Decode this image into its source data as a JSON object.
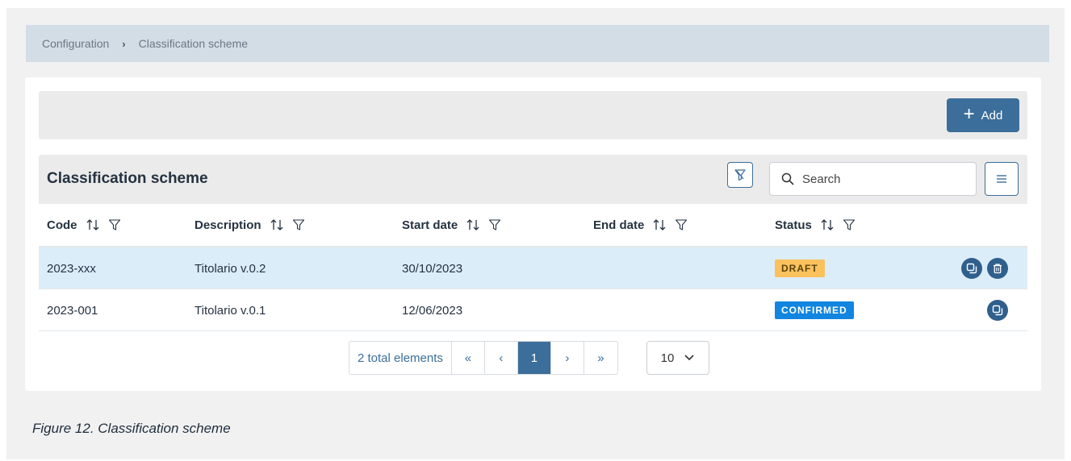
{
  "breadcrumb": {
    "items": [
      "Configuration",
      "Classification scheme"
    ],
    "separator": "›"
  },
  "toolbar": {
    "add_label": "Add"
  },
  "table": {
    "title": "Classification scheme",
    "search_placeholder": "Search",
    "columns": [
      "Code",
      "Description",
      "Start date",
      "End date",
      "Status"
    ],
    "rows": [
      {
        "code": "2023-xxx",
        "description": "Titolario v.0.2",
        "start_date": "30/10/2023",
        "end_date": "",
        "status": "DRAFT",
        "status_color": "#fbc15c",
        "actions": [
          "copy-icon",
          "delete-icon"
        ],
        "selected": true
      },
      {
        "code": "2023-001",
        "description": "Titolario v.0.1",
        "start_date": "12/06/2023",
        "end_date": "",
        "status": "CONFIRMED",
        "status_color": "#1185e0",
        "actions": [
          "copy-icon"
        ],
        "selected": false
      }
    ]
  },
  "pagination": {
    "total_label": "2 total elements",
    "first": "«",
    "prev": "‹",
    "current_page": "1",
    "next": "›",
    "last": "»",
    "page_size": "10"
  },
  "caption": "Figure 12. Classification scheme",
  "colors": {
    "primary": "#3b6e9a",
    "selected_row": "#dcedfa",
    "breadcrumb_bg": "#d3dde6"
  }
}
